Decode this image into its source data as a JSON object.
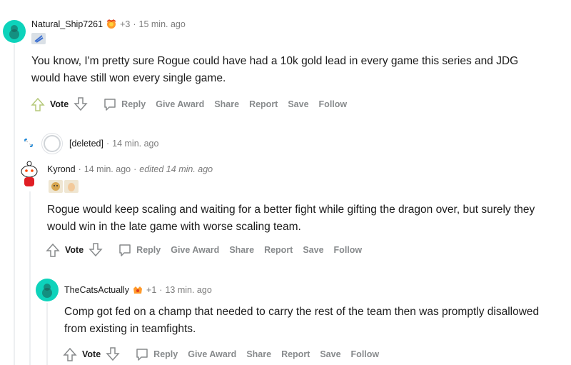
{
  "comments": [
    {
      "author": "Natural_Ship7261",
      "karma": "+3",
      "time": "15 min. ago",
      "body": "You know, I'm pretty sure Rogue could have had a 10k gold lead in every game this series and JDG would have still won every single game.",
      "vote_label": "Vote",
      "actions": [
        "Reply",
        "Give Award",
        "Share",
        "Report",
        "Save",
        "Follow"
      ],
      "avatar_color": "#0dd3bb"
    },
    {
      "author": "[deleted]",
      "time": "14 min. ago"
    },
    {
      "author": "Kyrond",
      "time": "14 min. ago",
      "edited": "edited 14 min. ago",
      "body": "Rogue would keep scaling and waiting for a better fight while gifting the dragon over, but surely they would win in the late game with worse scaling team.",
      "vote_label": "Vote",
      "actions": [
        "Reply",
        "Give Award",
        "Share",
        "Report",
        "Save",
        "Follow"
      ]
    },
    {
      "author": "TheCatsActually",
      "karma": "+1",
      "time": "13 min. ago",
      "body": "Comp got fed on a champ that needed to carry the rest of the team then was promptly disallowed from existing in teamfights.",
      "vote_label": "Vote",
      "actions": [
        "Reply",
        "Give Award",
        "Share",
        "Report",
        "Save",
        "Follow"
      ],
      "avatar_color": "#0dd3bb"
    }
  ],
  "separator": "·",
  "colors": {
    "text": "#1c1c1c",
    "muted": "#878a8c",
    "thread_line": "#edeff1",
    "avatar_teal": "#0dd3bb"
  }
}
